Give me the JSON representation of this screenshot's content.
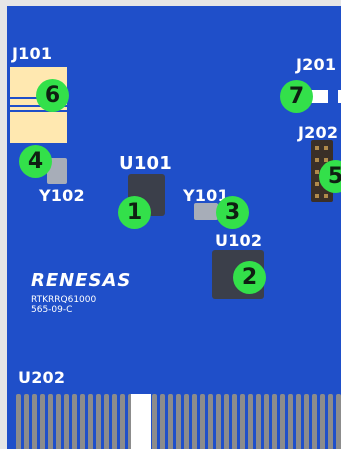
{
  "labels": {
    "j101": "J101",
    "j201": "J201",
    "j202": "J202",
    "u101": "U101",
    "y102": "Y102",
    "y101": "Y101",
    "u102": "U102",
    "u202": "U202"
  },
  "markers": [
    "1",
    "2",
    "3",
    "4",
    "5",
    "6",
    "7"
  ],
  "logo": {
    "brand": "RENESAS",
    "line1": "RTKRRQ61000",
    "line2": "565-09-C"
  },
  "colors": {
    "board": "#1f4fc9",
    "marker": "#33e04a",
    "chip": "#3b3f4a"
  }
}
